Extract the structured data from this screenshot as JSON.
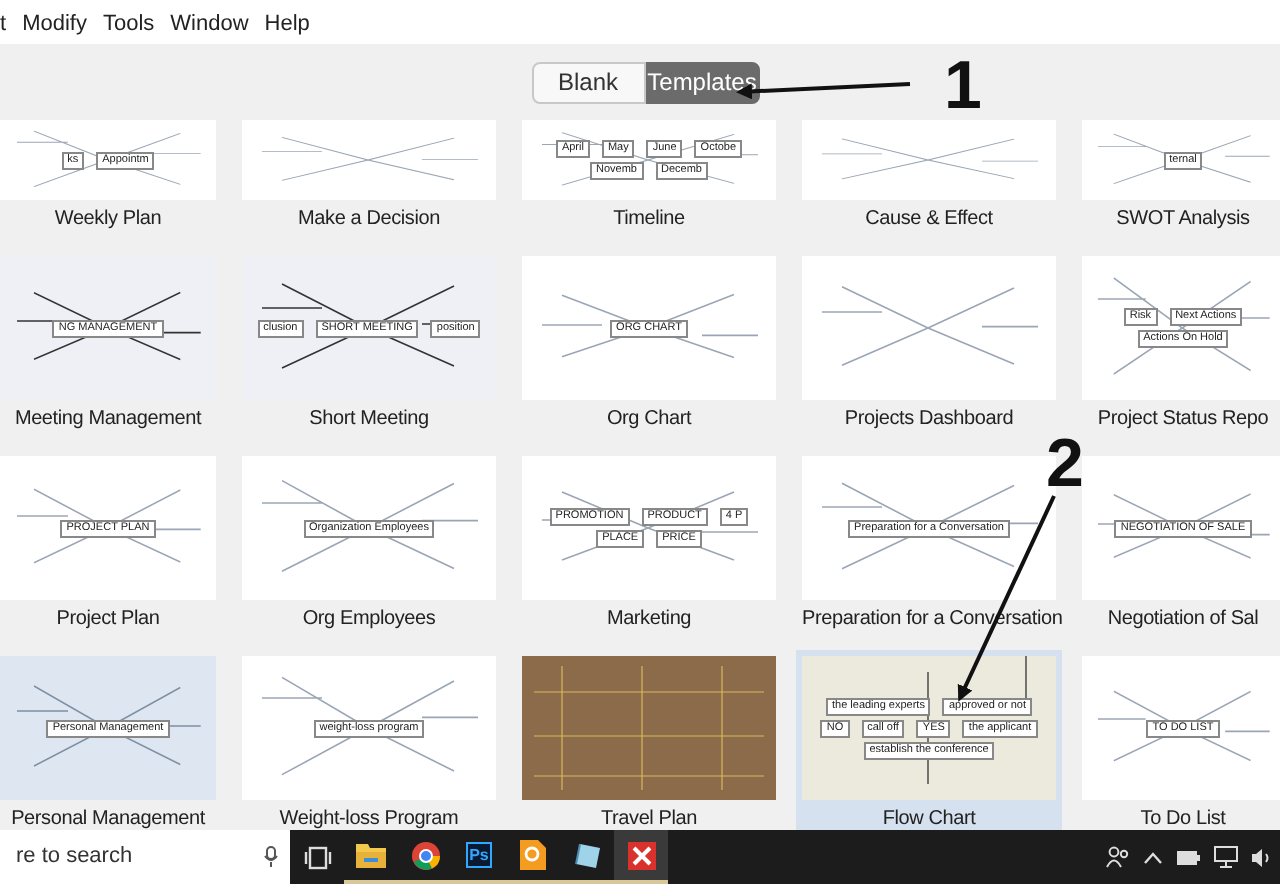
{
  "menu": [
    "t",
    "Modify",
    "Tools",
    "Window",
    "Help"
  ],
  "mode_switch": [
    {
      "label": "Blank",
      "selected": false
    },
    {
      "label": "Templates",
      "selected": true
    }
  ],
  "annotations": [
    {
      "label": "1"
    },
    {
      "label": "2"
    }
  ],
  "templates": [
    {
      "name": "Weekly Plan",
      "selected": false,
      "kind": "plain",
      "preview_texts": [
        "ks",
        "Appointm"
      ]
    },
    {
      "name": "Make a Decision",
      "selected": false,
      "kind": "plain"
    },
    {
      "name": "Timeline",
      "selected": false,
      "kind": "plain",
      "preview_texts": [
        "April",
        "May",
        "June",
        "Octobe",
        "Novemb",
        "Decemb"
      ]
    },
    {
      "name": "Cause & Effect",
      "selected": false,
      "kind": "plain"
    },
    {
      "name": "SWOT Analysis",
      "selected": false,
      "kind": "plain",
      "preview_texts": [
        "ternal"
      ]
    },
    {
      "name": "Meeting Management",
      "selected": false,
      "kind": "tinted",
      "preview_texts": [
        "NG MANAGEMENT"
      ]
    },
    {
      "name": "Short Meeting",
      "selected": false,
      "kind": "tinted",
      "preview_texts": [
        "clusion",
        "SHORT MEETING",
        "position"
      ]
    },
    {
      "name": "Org Chart",
      "selected": false,
      "kind": "plain",
      "preview_texts": [
        "ORG CHART"
      ]
    },
    {
      "name": "Projects Dashboard",
      "selected": false,
      "kind": "plain"
    },
    {
      "name": "Project Status Repo",
      "selected": false,
      "kind": "plain",
      "preview_texts": [
        "Risk",
        "Next Actions",
        "Actions On Hold"
      ]
    },
    {
      "name": "Project Plan",
      "selected": false,
      "kind": "plain",
      "preview_texts": [
        "PROJECT PLAN"
      ]
    },
    {
      "name": "Org Employees",
      "selected": false,
      "kind": "plain",
      "preview_texts": [
        "Organization Employees"
      ]
    },
    {
      "name": "Marketing",
      "selected": false,
      "kind": "plain",
      "preview_texts": [
        "PROMOTION",
        "PRODUCT",
        "4 P",
        "PLACE",
        "PRICE"
      ]
    },
    {
      "name": "Preparation for a Conversation",
      "selected": false,
      "kind": "plain",
      "preview_texts": [
        "Preparation for a Conversation"
      ]
    },
    {
      "name": "Negotiation of Sal",
      "selected": false,
      "kind": "plain",
      "preview_texts": [
        "NEGOTIATION OF SALE"
      ]
    },
    {
      "name": "Personal Management",
      "selected": false,
      "kind": "map",
      "preview_texts": [
        "Personal Management"
      ]
    },
    {
      "name": "Weight-loss Program",
      "selected": false,
      "kind": "plain",
      "preview_texts": [
        "weight-loss program"
      ]
    },
    {
      "name": "Travel Plan",
      "selected": false,
      "kind": "wood"
    },
    {
      "name": "Flow Chart",
      "selected": true,
      "kind": "flow",
      "preview_texts": [
        "the leading experts",
        "approved or not",
        "NO",
        "call off",
        "YES",
        "the applicant",
        "establish the conference"
      ]
    },
    {
      "name": "To Do List",
      "selected": false,
      "kind": "plain",
      "preview_texts": [
        "TO DO LIST"
      ]
    }
  ],
  "taskbar": {
    "search_placeholder": "re to search",
    "apps": [
      {
        "kind": "taskview",
        "running": false,
        "active": false
      },
      {
        "kind": "folder",
        "running": true,
        "active": false
      },
      {
        "kind": "browser",
        "running": true,
        "active": false
      },
      {
        "kind": "ps",
        "label": "Ps",
        "running": true,
        "active": false
      },
      {
        "kind": "orange",
        "running": true,
        "active": false
      },
      {
        "kind": "notepad",
        "running": true,
        "active": false
      },
      {
        "kind": "xmind",
        "running": true,
        "active": true
      }
    ]
  }
}
